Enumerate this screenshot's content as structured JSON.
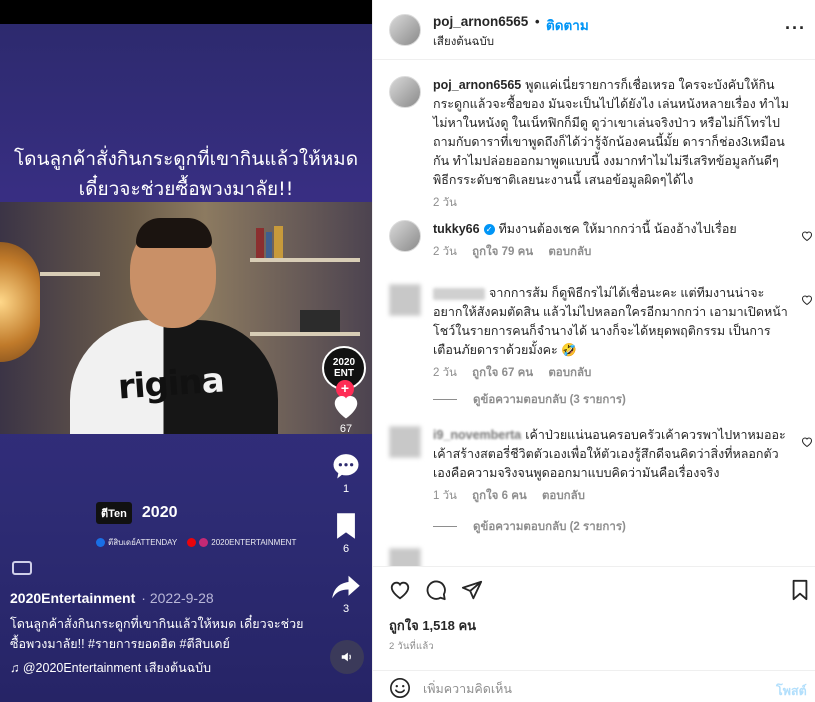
{
  "media": {
    "caption_line1": "โดนลูกค้าสั่งกินกระดูกที่เขากินแล้วให้หมด",
    "caption_line2": "เดี๋ยวจะช่วยซื้อพวงมาลัย!!",
    "shirt_text_dark": "rigin",
    "shirt_text_light": "a",
    "channel_badge": "2020",
    "channel_badge_sub": "ENT",
    "follow_plus": "+",
    "rail": {
      "like_count": "67",
      "comment_count": "1",
      "save_count": "6",
      "share_count": "3"
    },
    "brand_logo_a": "ตีTen",
    "brand_logo_b": "2020",
    "socials": {
      "facebook": "ตีสิบเดย์ATTENDAY",
      "youtube": "2020ENTERTAINMENT"
    },
    "author": "2020Entertainment",
    "date": "· 2022-9-28",
    "description": "โดนลูกค้าสั่งกินกระดูกที่เขากินแล้วให้หมด เดี๋ยวจะช่วยซื้อพวงมาลัย!! #รายการยอดฮิต #ตีสิบเดย์",
    "sound": "♫ @2020Entertainment เสียงต้นฉบับ",
    "volume_icon": "speaker-icon"
  },
  "header": {
    "username": "poj_arnon6565",
    "dot": "•",
    "follow_label": "ติดตาม",
    "subtitle": "เสียงต้นฉบับ",
    "more": "···"
  },
  "comments": [
    {
      "user": "poj_arnon6565",
      "text": "พูดแค่เนี่ยรายการก็เชื่อเหรอ ใครจะบังคับให้กินกระดูกแล้วจะซื้อของ มันจะเป็นไปได้ยังไง เล่นหนังหลายเรื่อง ทำไมไม่หาในหนังดู ในเน็ทฟิกก็มีดู ดูว่าเขาเล่นจริงป่าว หรือไม่ก็โทรไปถามกับดาราที่เขาพูดถึงก็ได้ว่ารู้จักน้องคนนี้มั้ย ดาราก็ช่อง3เหมือนกัน ทำไมปล่อยออกมาพูดแบบนี้ งงมากทำไมไม่รีเสริทข้อมูลกันดีๆพิธีกรระดับชาติเลยนะงานนี้ เสนอข้อมูลผิดๆได้ไง",
      "time": "2 วัน"
    },
    {
      "user": "tukky66",
      "verified": "✓",
      "text": "ทีมงานต้องเชค ให้มากกว่านี้ น้องอ้างไปเรื่อย",
      "time": "2 วัน",
      "likes": "ถูกใจ 79 คน",
      "reply": "ตอบกลับ"
    },
    {
      "user": "",
      "text": "จากการส้ม ก็ดูพิธีกรไม่ได้เชื่อนะคะ แต่ทีมงานน่าจะอยากให้สังคมตัดสิน แล้วไม่ไปหลอกใครอีกมากกว่า เอามาเปิดหน้าโชว์ในรายการคนก็จำนางได้ นางก็จะได้หยุดพฤติกรรม เป็นการเตือนภัยดาราด้วยมั้งคะ 🤣",
      "time": "2 วัน",
      "likes": "ถูกใจ 67 คน",
      "reply": "ตอบกลับ",
      "view_replies": "ดูข้อความตอบกลับ (3 รายการ)"
    },
    {
      "user": "i9_novemberta",
      "text": "เค้าป่วยแน่นอนครอบครัวเค้าควรพาไปหาหมออะเค้าสร้างสตอรี่ชีวิตตัวเองเพื่อให้ตัวเองรู้สึกดีจนคิดว่าสิ่งที่หลอกตัวเองคือความจริงจนพูดออกมาแบบคิดว่ามันคือเรื่องจริง",
      "time": "1 วัน",
      "likes": "ถูกใจ 6 คน",
      "reply": "ตอบกลับ",
      "view_replies": "ดูข้อความตอบกลับ (2 รายการ)"
    }
  ],
  "actions": {
    "like_icon": "heart-icon",
    "comment_icon": "comment-icon",
    "share_icon": "send-icon",
    "save_icon": "bookmark-icon",
    "likes": "ถูกใจ 1,518 คน",
    "time_ago": "2 วันที่แล้ว"
  },
  "add_comment": {
    "placeholder": "เพิ่มความคิดเห็น",
    "post_label": "โพสต์"
  },
  "colors": {
    "link": "#0095f6",
    "post_disabled": "#b2dffc",
    "muted": "#8e8e8e"
  }
}
